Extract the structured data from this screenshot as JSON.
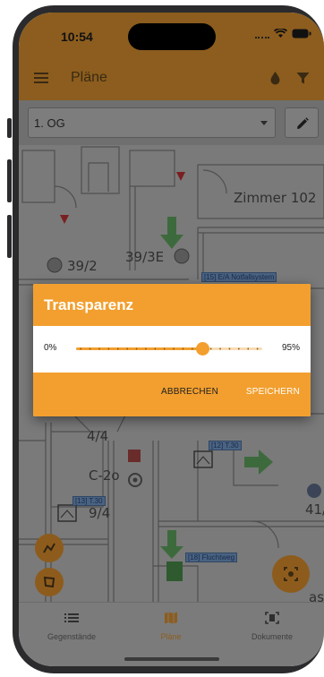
{
  "status_bar": {
    "time": "10:54"
  },
  "app_bar": {
    "title": "Pläne"
  },
  "level_selector": {
    "value": "1. OG"
  },
  "plan": {
    "labels": [
      "Zimmer 102",
      "39/2",
      "39/3E",
      "4/4",
      "C-2o",
      "9/4",
      "41/",
      "as"
    ],
    "tags": [
      "[15] E/A Notfallsystem",
      "[12] T.30",
      "[13] T.30",
      "[18] Fluchtweg"
    ]
  },
  "dialog": {
    "title": "Transparenz",
    "min_label": "0%",
    "max_label": "95%",
    "slider_value_percent": 68,
    "cancel_label": "ABBRECHEN",
    "save_label": "SPEICHERN"
  },
  "bottom_nav": {
    "items": [
      {
        "label": "Gegenstände",
        "icon": "list-icon",
        "active": false
      },
      {
        "label": "Pläne",
        "icon": "map-icon",
        "active": true
      },
      {
        "label": "Dokumente",
        "icon": "document-scan-icon",
        "active": false
      }
    ]
  },
  "colors": {
    "accent": "#f29f2f",
    "accent_dimmed": "#8c5d1e",
    "scrim_gray": "#7a7a7a"
  }
}
